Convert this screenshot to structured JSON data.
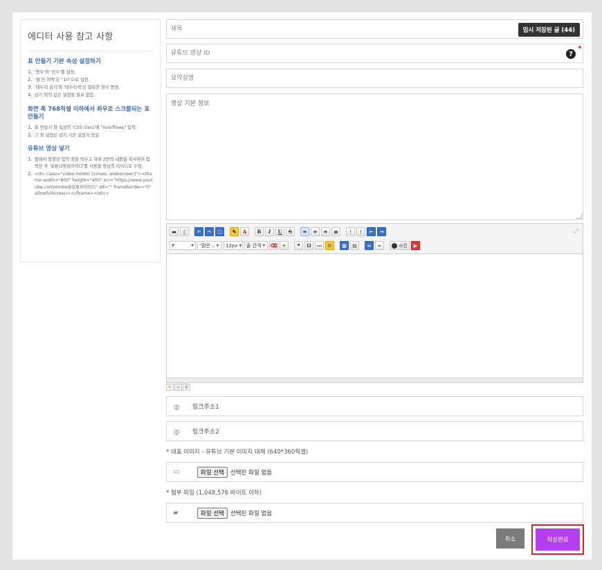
{
  "guide": {
    "title": "에디터 사용 참고 사항",
    "sections": [
      {
        "heading": "표 만들기 기본 속성 설정하기",
        "items": [
          "'종수'와 '칸수'를 설정.",
          "'셀 안 여백'은 \"10\"으로 설정.",
          "'테두리 굵기'와 '테두리색'은 필요한 경우 변경.",
          "상기 외의 값은 설정할 필요 없음."
        ]
      },
      {
        "heading": "화면 폭 768픽셀 이하에서 좌우로 스크롤되는 표 만들기",
        "items": [
          "표 만들기 창 속성의 'CSS class'에 \"overflowx\" 입력.",
          "그 외 설정은 상기 기본 설정과 동일"
        ]
      },
      {
        "heading": "유튜브 영상 넣기",
        "items": [
          "플레이 동영상 입력 창을 띄우고 아래 2번의 내용을 복사하여 입력한 후 '유튜브영상아이디'를 사용할 영상의 아이디로 수정.",
          "<div class=\"video-holder [vimeo, widescreen]\"><iframe width=\"800\" height=\"450\" src=\"https://www.youtube.com/embed/유튜브아이디\" alt=\"\" frameborder=\"0\" allowfullscreen></iframe></div>"
        ]
      }
    ]
  },
  "form": {
    "title_placeholder": "제목",
    "temp_saved_label": "임시 저장된 글 (44)",
    "youtube_placeholder": "유튜브 영상 ID",
    "help_glyph": "?",
    "summary_placeholder": "요약설명",
    "video_info_placeholder": "영상 기본 정보",
    "link1_placeholder": "링크주소1",
    "link2_placeholder": "링크주소2",
    "image_note": "* 대표 이미지 - 유튜브 기본 이미지 대체 (640*360픽셀)",
    "attach_note": "* 첨부 파일 (1,048,576 바이트 이하)",
    "file_button_label": "파일 선택",
    "no_file_label": "선택된 파일 없음",
    "cancel_label": "취소",
    "submit_label": "작성완료"
  },
  "toolbar": {
    "format_select": "P",
    "font_select": "\"맑은...",
    "size_select": "12px",
    "line_height_select": "줄 간격",
    "photo_label": "사진",
    "bold": "B",
    "italic": "I",
    "underline": "U",
    "strike": "S",
    "omega": "Ω",
    "quote": "❝"
  },
  "colors": {
    "accent": "#b43ef0",
    "highlight_border": "#d91e2a",
    "guide_heading": "#3a6cb5",
    "cancel": "#7a7a7a"
  }
}
